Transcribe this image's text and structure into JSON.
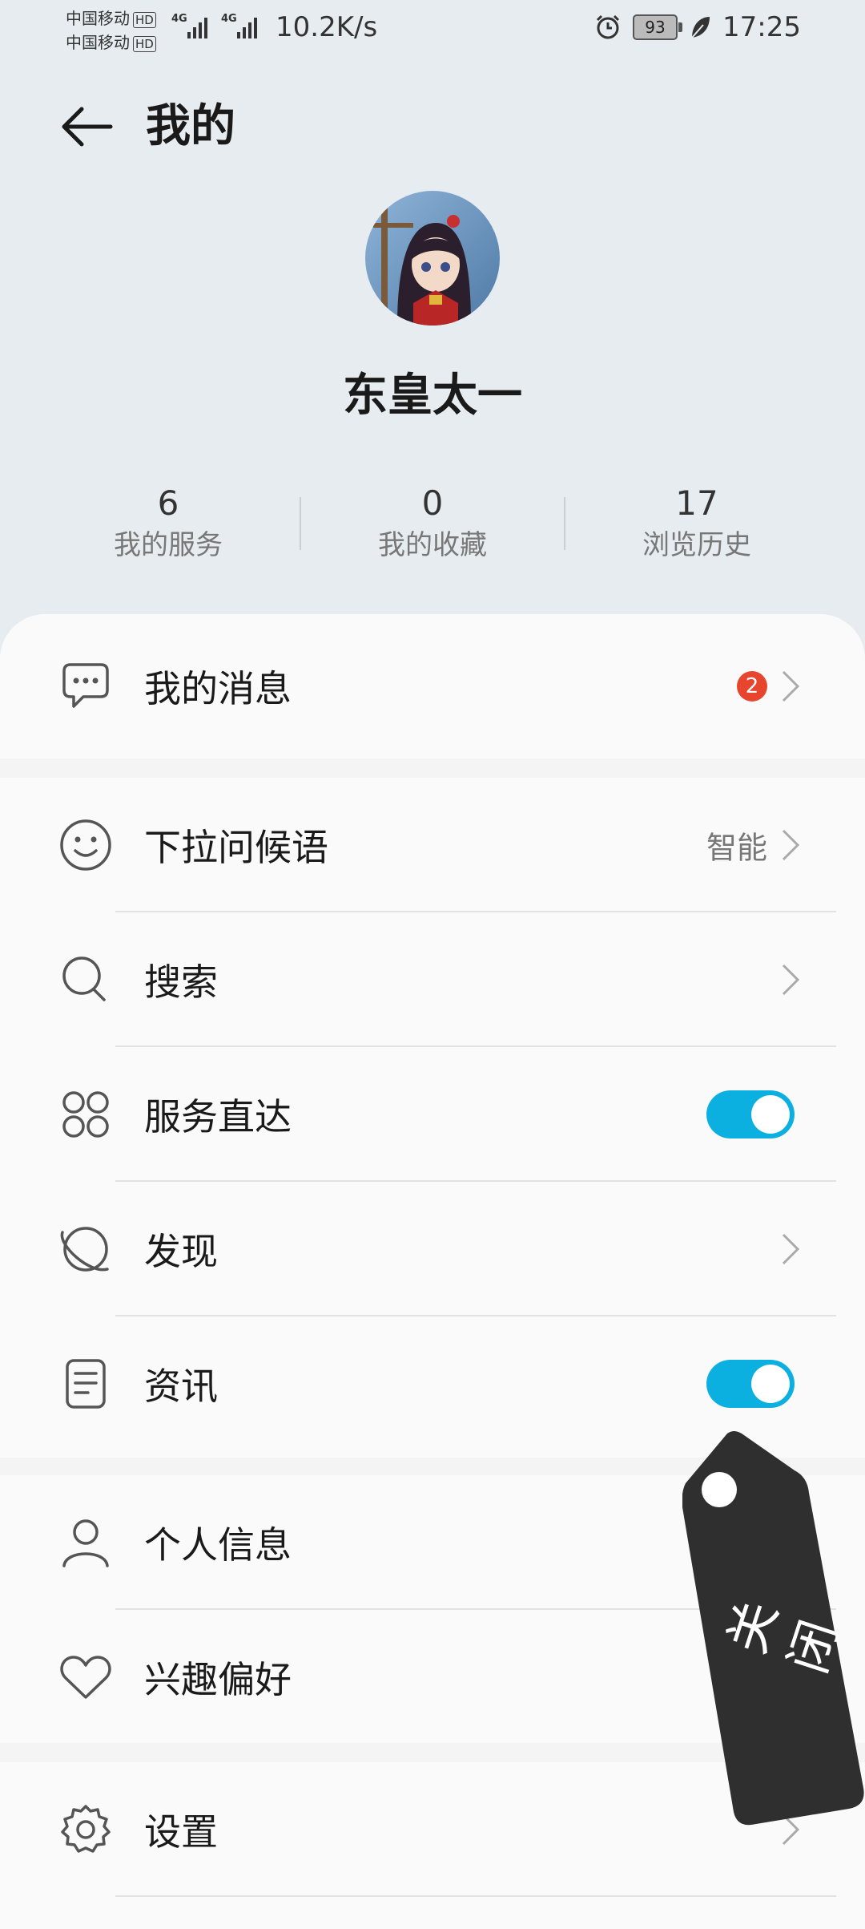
{
  "status_bar": {
    "carrier_1": "中国移动",
    "carrier_2": "中国移动",
    "hd_badge": "HD",
    "net_tag": "4G",
    "net_speed": "10.2K/s",
    "battery": "93",
    "time": "17:25",
    "icons": [
      "alarm-icon",
      "battery-icon",
      "leaf-icon"
    ]
  },
  "header": {
    "title": "我的"
  },
  "profile": {
    "username": "东皇太一"
  },
  "stats": [
    {
      "value": "6",
      "label": "我的服务"
    },
    {
      "value": "0",
      "label": "我的收藏"
    },
    {
      "value": "17",
      "label": "浏览历史"
    }
  ],
  "menu": {
    "messages": {
      "label": "我的消息",
      "badge": "2"
    },
    "greeting": {
      "label": "下拉问候语",
      "value": "智能"
    },
    "search": {
      "label": "搜索"
    },
    "service_direct": {
      "label": "服务直达",
      "toggle_on": true
    },
    "discover": {
      "label": "发现"
    },
    "news": {
      "label": "资讯",
      "toggle_on": true
    },
    "personal_info": {
      "label": "个人信息"
    },
    "interests": {
      "label": "兴趣偏好"
    },
    "settings": {
      "label": "设置"
    }
  },
  "floating_tag": {
    "label": "关闭"
  },
  "colors": {
    "accent": "#0bb0e0",
    "badge": "#e8452e",
    "tag": "#2f2f2f"
  }
}
